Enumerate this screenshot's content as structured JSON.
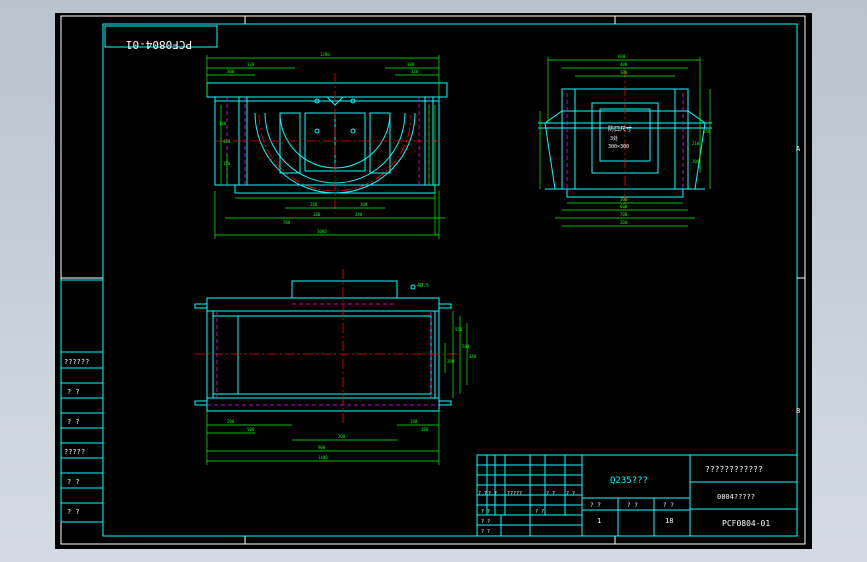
{
  "colors": {
    "background": "#000000",
    "frame": "#ffffff",
    "outline": "#00ffff",
    "dimension": "#00ff00",
    "centerline": "#ff0000",
    "hidden": "#ff00ff"
  },
  "drawing_number_mirrored": "PCF0804-01",
  "zone_labels": {
    "a": "A",
    "b": "B"
  },
  "left_table_labels": [
    "??????",
    "? ?",
    "? ?",
    "?????",
    "? ?",
    "? ?"
  ],
  "front_view": {
    "dims_top": [
      "1280",
      "320",
      "300",
      "380",
      "320"
    ],
    "dims_bottom": [
      "280",
      "300",
      "300",
      "240",
      "700",
      "1080"
    ],
    "dims_left": [
      "140",
      "400",
      "150"
    ]
  },
  "side_view": {
    "opening_label": "防口尺寸",
    "opening_size": "300×300",
    "note_mark": "3处",
    "dims_top": [
      "600",
      "400",
      "300"
    ],
    "dims_bottom": [
      "300",
      "600",
      "700",
      "200"
    ],
    "dims_right": [
      "150",
      "210",
      "200"
    ]
  },
  "top_view": {
    "hole_label": "4Ø.5",
    "dims_bottom": [
      "200",
      "190",
      "500",
      "180",
      "200",
      "900",
      "1400"
    ],
    "dims_right": [
      "550",
      "500",
      "340",
      "200"
    ]
  },
  "title_block": {
    "material": "Q235???",
    "name": "????????????",
    "part_name": "0804?????",
    "drawing_number": "PCF0804-01",
    "scale": "1",
    "sheet": "18",
    "sign_labels": [
      "? ?",
      "? ?",
      "?????",
      "? ?",
      "? ?"
    ],
    "sign_rows": [
      "? ?",
      "? ?",
      "? ?",
      "? ?"
    ],
    "stage_labels": [
      "? ?",
      "? ?",
      "? ?"
    ]
  }
}
